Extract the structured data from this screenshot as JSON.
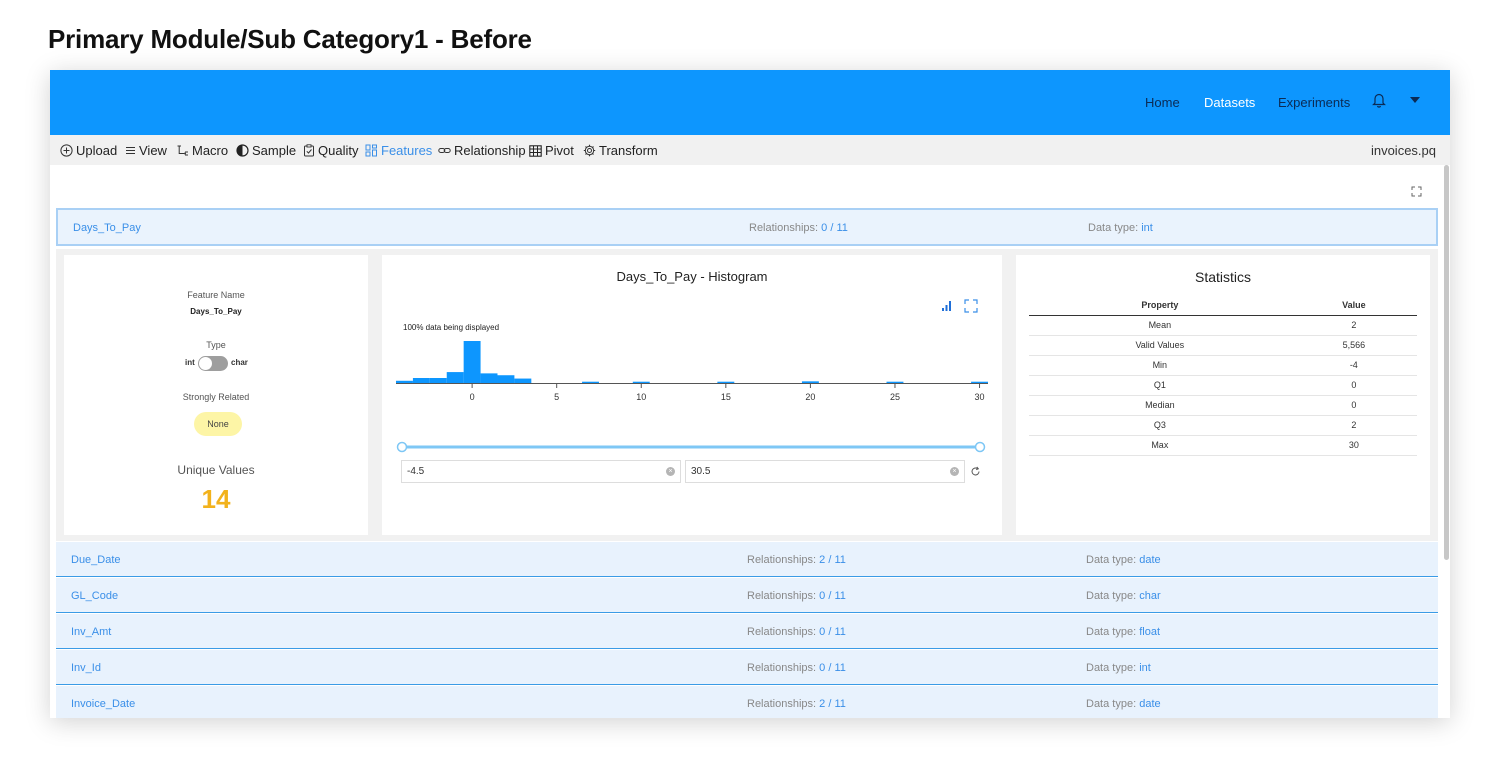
{
  "page_title": "Primary Module/Sub Category1 - Before",
  "nav": {
    "home": "Home",
    "datasets": "Datasets",
    "experiments": "Experiments",
    "bell_icon": "bell-icon",
    "menu_icon": "caret-down-icon"
  },
  "toolbar": {
    "items": [
      "Upload",
      "View",
      "Macro",
      "Sample",
      "Quality",
      "Features",
      "Relationship",
      "Pivot",
      "Transform"
    ],
    "active": "Features",
    "filename": "invoices.pq"
  },
  "colors": {
    "brand": "#0d96fe",
    "accent": "#3a8fe8",
    "highlight": "#f2b21c",
    "pill": "#fdf5a6"
  },
  "rows": [
    {
      "name": "Days_To_Pay",
      "relationships_label": "Relationships:",
      "relationships": "0 / 11",
      "datatype_label": "Data type:",
      "datatype": "int"
    },
    {
      "name": "Due_Date",
      "relationships_label": "Relationships:",
      "relationships": "2 / 11",
      "datatype_label": "Data type:",
      "datatype": "date"
    },
    {
      "name": "GL_Code",
      "relationships_label": "Relationships:",
      "relationships": "0 / 11",
      "datatype_label": "Data type:",
      "datatype": "char"
    },
    {
      "name": "Inv_Amt",
      "relationships_label": "Relationships:",
      "relationships": "0 / 11",
      "datatype_label": "Data type:",
      "datatype": "float"
    },
    {
      "name": "Inv_Id",
      "relationships_label": "Relationships:",
      "relationships": "0 / 11",
      "datatype_label": "Data type:",
      "datatype": "int"
    },
    {
      "name": "Invoice_Date",
      "relationships_label": "Relationships:",
      "relationships": "2 / 11",
      "datatype_label": "Data type:",
      "datatype": "date"
    }
  ],
  "feature": {
    "name_label": "Feature Name",
    "name": "Days_To_Pay",
    "type_label": "Type",
    "type_left": "int",
    "type_right": "char",
    "strongly_related_label": "Strongly Related",
    "strongly_related": "None",
    "unique_label": "Unique Values",
    "unique_value": "14"
  },
  "histogram": {
    "title": "Days_To_Pay - Histogram",
    "note": "100% data being displayed",
    "range_min": "-4.5",
    "range_max": "30.5"
  },
  "chart_data": {
    "type": "bar",
    "title": "Days_To_Pay - Histogram",
    "x": [
      -4,
      -3,
      -2,
      -1,
      0,
      1,
      2,
      3,
      7,
      10,
      15,
      20,
      25,
      30
    ],
    "values": [
      1.2,
      2.7,
      2.7,
      5.9,
      22.7,
      5.2,
      4.2,
      2.4,
      0.7,
      0.7,
      0.7,
      0.9,
      0.7,
      0.7
    ],
    "xticks": [
      0,
      5,
      10,
      15,
      20,
      25,
      30
    ],
    "xlim": [
      -4.5,
      30.5
    ],
    "ylabel": "",
    "xlabel": ""
  },
  "statistics": {
    "title": "Statistics",
    "col_property": "Property",
    "col_value": "Value",
    "rows": [
      {
        "property": "Mean",
        "value": "2"
      },
      {
        "property": "Valid Values",
        "value": "5,566"
      },
      {
        "property": "Min",
        "value": "-4"
      },
      {
        "property": "Q1",
        "value": "0"
      },
      {
        "property": "Median",
        "value": "0"
      },
      {
        "property": "Q3",
        "value": "2"
      },
      {
        "property": "Max",
        "value": "30"
      }
    ]
  }
}
